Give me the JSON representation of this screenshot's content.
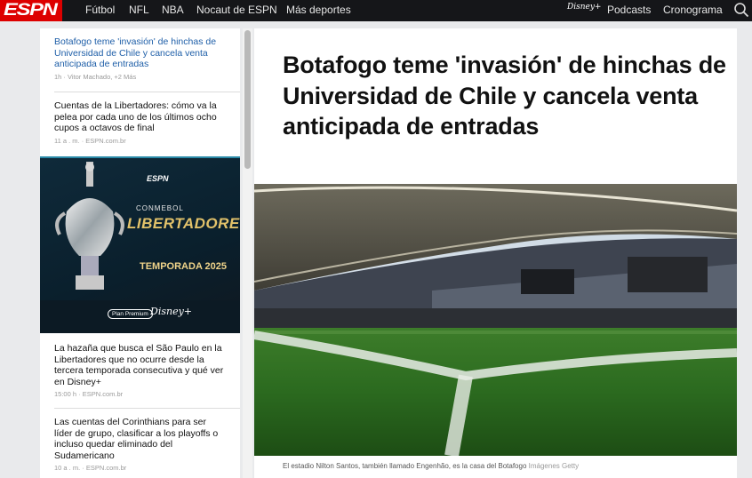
{
  "header": {
    "logo": "ESPN",
    "nav": [
      "Fútbol",
      "NFL",
      "NBA",
      "Nocaut de ESPN",
      "Más deportes"
    ],
    "right_nav": [
      "Podcasts",
      "Cronograma"
    ],
    "disney_mark": "Disney+"
  },
  "sidebar": {
    "stories": [
      {
        "title": "Botafogo teme 'invasión' de hinchas de Universidad de Chile y cancela venta anticipada de entradas",
        "time": "1h",
        "source": "Vitor Machado, +2 Más",
        "active": true
      },
      {
        "title": "Cuentas de la Libertadores: cómo va la pelea por cada uno de los últimos ocho cupos a octavos de final",
        "time": "11 a . m.",
        "source": "ESPN.com.br"
      },
      {
        "title": "La hazaña que busca el São Paulo en la Libertadores que no ocurre desde la tercera temporada consecutiva y qué ver en Disney+",
        "time": "15:00 h",
        "source": "ESPN.com.br"
      },
      {
        "title": "Las cuentas del Corinthians para ser líder de grupo, clasificar a los playoffs o incluso quedar eliminado del Sudamericano",
        "time": "10 a . m.",
        "source": "ESPN.com.br"
      }
    ],
    "ad": {
      "espn": "ESPN",
      "conmebol": "CONMEBOL",
      "libertadores": "LIBERTADORES",
      "season": "TEMPORADA 2025",
      "plan": "Plan Premium",
      "disney": "Disney+"
    }
  },
  "article": {
    "headline": "Botafogo teme 'invasión' de hinchas de Universidad de Chile y cancela venta anticipada de entradas",
    "caption": "El estadio Nilton Santos, también llamado Engenhão, es la casa del Botafogo",
    "credit": "Imágenes Getty"
  },
  "colors": {
    "accent_red": "#dd0000",
    "link_blue": "#1f5fa8",
    "topbar": "#151619"
  }
}
